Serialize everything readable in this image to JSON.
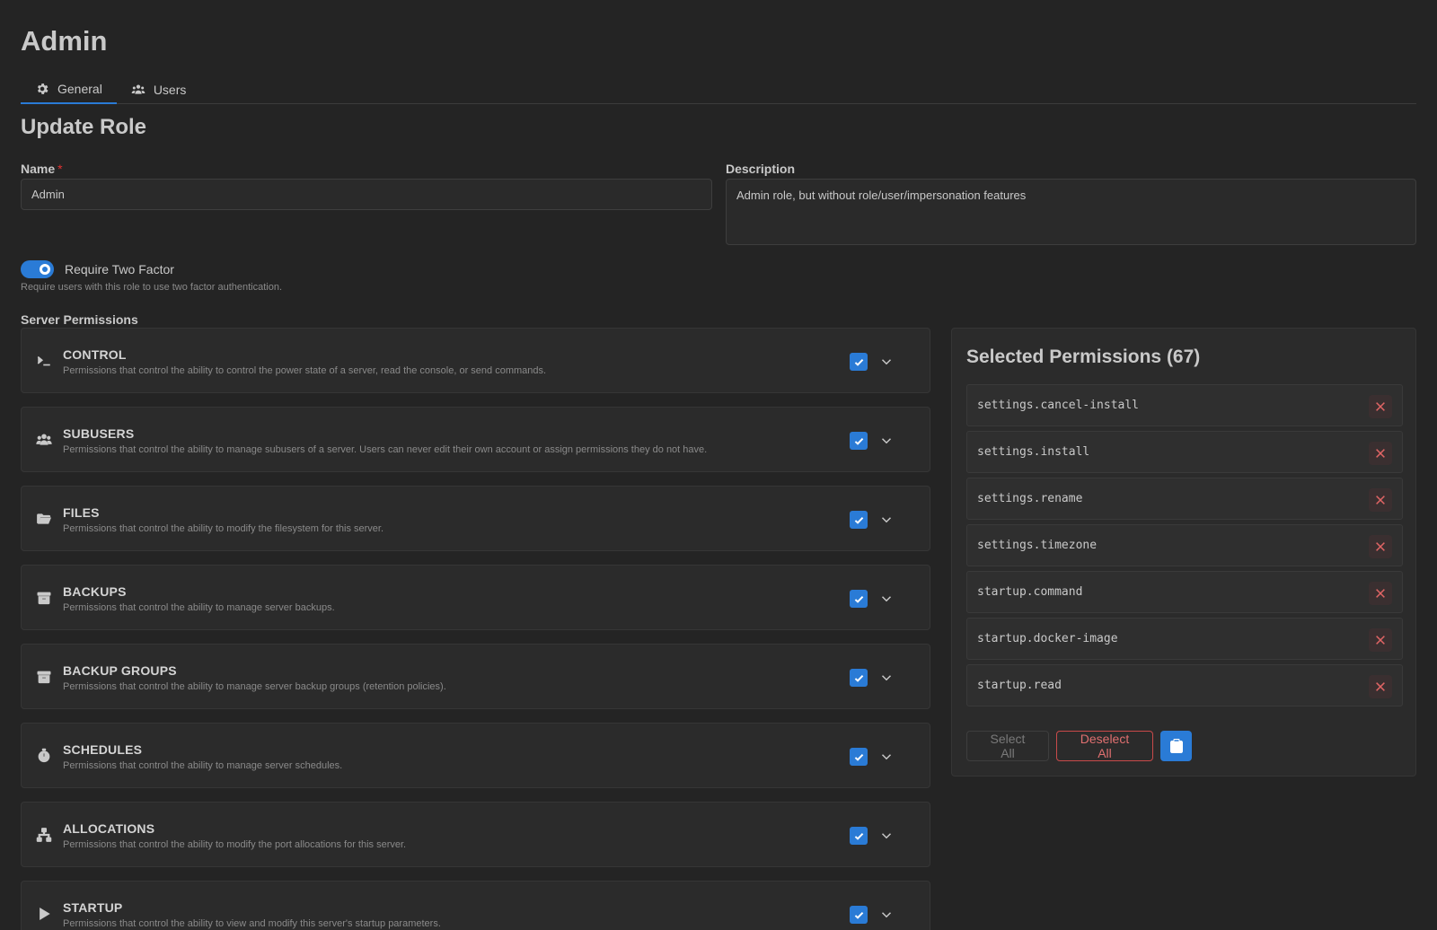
{
  "app": {
    "title": "Admin"
  },
  "tabs": [
    {
      "label": "General",
      "icon": "gear-icon",
      "active": true
    },
    {
      "label": "Users",
      "icon": "users-icon",
      "active": false
    }
  ],
  "form": {
    "section_title": "Update Role",
    "name_label": "Name",
    "name_required": "*",
    "name_value": "Admin",
    "description_label": "Description",
    "description_value": "Admin role, but without role/user/impersonation features",
    "two_factor": {
      "label": "Require Two Factor",
      "description": "Require users with this role to use two factor authentication.",
      "enabled": true
    }
  },
  "permissions": {
    "heading": "Server Permissions",
    "groups": [
      {
        "title": "CONTROL",
        "description": "Permissions that control the ability to control the power state of a server, read the console, or send commands.",
        "icon": "terminal-icon",
        "checked": true
      },
      {
        "title": "SUBUSERS",
        "description": "Permissions that control the ability to manage subusers of a server. Users can never edit their own account or assign permissions they do not have.",
        "icon": "users-icon",
        "checked": true
      },
      {
        "title": "FILES",
        "description": "Permissions that control the ability to modify the filesystem for this server.",
        "icon": "folder-icon",
        "checked": true
      },
      {
        "title": "BACKUPS",
        "description": "Permissions that control the ability to manage server backups.",
        "icon": "archive-icon",
        "checked": true
      },
      {
        "title": "BACKUP GROUPS",
        "description": "Permissions that control the ability to manage server backup groups (retention policies).",
        "icon": "archive-icon",
        "checked": true
      },
      {
        "title": "SCHEDULES",
        "description": "Permissions that control the ability to manage server schedules.",
        "icon": "stopwatch-icon",
        "checked": true
      },
      {
        "title": "ALLOCATIONS",
        "description": "Permissions that control the ability to modify the port allocations for this server.",
        "icon": "network-icon",
        "checked": true
      },
      {
        "title": "STARTUP",
        "description": "Permissions that control the ability to view and modify this server's startup parameters.",
        "icon": "play-icon",
        "checked": true
      }
    ]
  },
  "selected": {
    "title": "Selected Permissions (67)",
    "items": [
      "settings.cancel-install",
      "settings.install",
      "settings.rename",
      "settings.timezone",
      "startup.command",
      "startup.docker-image",
      "startup.read"
    ],
    "select_all_label": "Select All",
    "deselect_all_label": "Deselect All"
  },
  "colors": {
    "background": "#242424",
    "accent": "#2a7bd6",
    "danger": "#e07070"
  }
}
